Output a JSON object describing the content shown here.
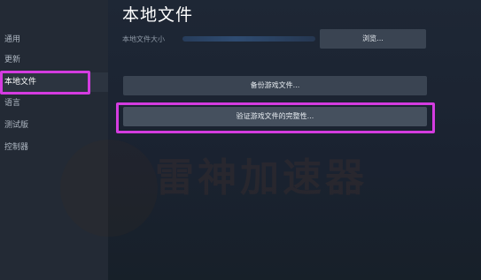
{
  "sidebar": {
    "items": [
      {
        "label": "通用"
      },
      {
        "label": "更新"
      },
      {
        "label": "本地文件"
      },
      {
        "label": "语言"
      },
      {
        "label": "测试版"
      },
      {
        "label": "控制器"
      }
    ]
  },
  "main": {
    "title": "本地文件",
    "size_label": "本地文件大小",
    "browse_label": "浏览...",
    "backup_label": "备份游戏文件...",
    "verify_label": "验证游戏文件的完整性..."
  },
  "watermark": {
    "text": "雷神加速器"
  },
  "colors": {
    "highlight": "#d43ce0",
    "sidebar_bg": "#232a35",
    "main_bg": "#1b2431",
    "button_bg": "#3a4452"
  }
}
